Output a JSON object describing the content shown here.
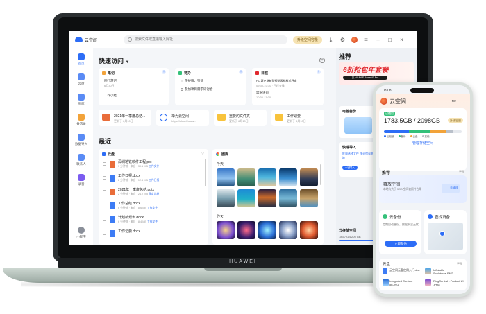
{
  "app": {
    "brand": "HUAWEI",
    "title": "云空间",
    "search_placeholder": "搜索文件或直接输入网址",
    "upgrade_label": "升级空间容量"
  },
  "sidebar": {
    "items": [
      {
        "label": "首页",
        "active": true
      },
      {
        "label": "云盘"
      },
      {
        "label": "图库"
      },
      {
        "label": "备忘录"
      },
      {
        "label": "数据导入"
      },
      {
        "label": "联系人"
      },
      {
        "label": "录音"
      },
      {
        "label": "小程序"
      }
    ]
  },
  "quick": {
    "title": "快速访问",
    "notes": {
      "title": "笔记",
      "lines": [
        "图行游记",
        "6月30日",
        "工作小结"
      ]
    },
    "todo": {
      "title": "待办",
      "lines": [
        "带护照、签证",
        "参加项目需求研讨会"
      ]
    },
    "schedule": {
      "title": "日程",
      "lines": [
        "PC 客户端新版视觉风格样式评审",
        "09:30-10:30 · 日程安排",
        "需求评审",
        "10:30-11:00"
      ]
    },
    "shortcuts": [
      {
        "title": "2021年一季度总结...",
        "sub": "更新于 6月10日"
      },
      {
        "title": "华为云空间",
        "sub": "https://cloud.huaw..."
      },
      {
        "title": "重要的文件夹",
        "sub": "更新于 6月10日"
      },
      {
        "title": "工作记要",
        "sub": "更新于 6月10日"
      }
    ]
  },
  "recent": {
    "title": "最近",
    "drive": {
      "title": "云盘",
      "files": [
        {
          "name": "深圳地铁软件工程.ppt",
          "meta": "3 分钟前 · 来自 · 30.1 MB",
          "loc": "工作文件"
        },
        {
          "name": "工作日报.docx",
          "meta": "2 分钟前 · 来自 · 12.5 MB",
          "loc": "工作日报"
        },
        {
          "name": "2021年一季度总结.pptx",
          "meta": "2 分钟前 · 来自 · 24.2 MB",
          "loc": "季度总结"
        },
        {
          "name": "工作总结.docx",
          "meta": "6 分钟前 · 来自 · 8.6 MB",
          "loc": "工作文件"
        },
        {
          "name": "计划新规表.docx",
          "meta": "6 分钟前 · 来自 · 8.4 MB",
          "loc": "工作文件"
        },
        {
          "name": "工作记要.docx",
          "meta": "",
          "loc": ""
        }
      ]
    },
    "gallery": {
      "title": "图库",
      "today": "今天",
      "yesterday": "昨天"
    }
  },
  "right_pane": {
    "title": "推荐",
    "promo_title": "6折抢包年套餐",
    "promo_band": "赢 HUAWEI Mate 40 Pro",
    "backup_title": "电脑备份",
    "import_title": "快速导入",
    "import_sub": "批量选择文件 快速保存到本地",
    "import_btn": "一键导入",
    "storage_title": "云存储空间",
    "storage_value": "183.7 GB/205 GB"
  },
  "phone": {
    "time": "08:08",
    "title": "云空间",
    "used_label": "已使用",
    "used": "1783.5GB / 2098GB",
    "upgrade": "升级容量",
    "legend": [
      "云相册",
      "备份",
      "云盘",
      "其他"
    ],
    "manage": "管理存储空间",
    "rec_title": "推荐",
    "more": "更多",
    "rec_card_title": "释放空间",
    "rec_card_sub": "本地有大于 5GB 空间被照片占用",
    "rec_card_btn": "去清理",
    "backup_title": "云备份",
    "backup_sub": "定期自动备份，数据安全无忧",
    "backup_btn": "立即备份",
    "find_title": "查找设备",
    "drive_title": "云盘",
    "files": [
      {
        "name": "云空间云盘使用入门.doc"
      },
      {
        "name": "Inflatable Sculptures.PNG"
      },
      {
        "name": "Integrated Content on.JPG"
      },
      {
        "name": "RingCentral - Product UI .PNG"
      }
    ]
  },
  "colors": {
    "accent": "#2d6df6",
    "promo_red": "#e0282e",
    "upgrade_bg": "#f6e3b3",
    "bar_green": "#34c17a",
    "bar_blue": "#2d6df6",
    "bar_orange": "#f2a33a",
    "bar_grey": "#b9c0ca"
  }
}
